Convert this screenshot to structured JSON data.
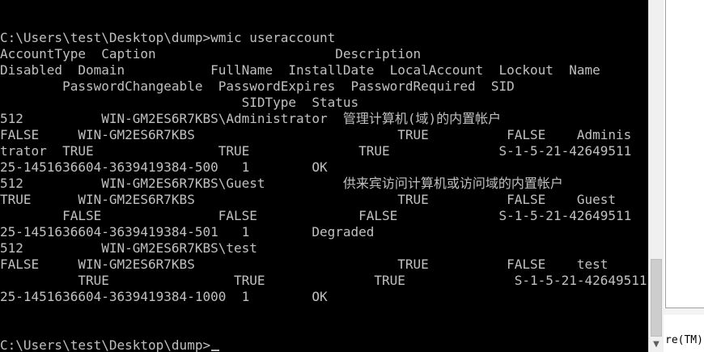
{
  "console": {
    "lines": [
      "",
      "",
      "C:\\Users\\test\\Desktop\\dump>wmic useraccount",
      "AccountType  Caption                       Description",
      "Disabled  Domain           FullName  InstallDate  LocalAccount  Lockout  Name",
      "        PasswordChangeable  PasswordExpires  PasswordRequired  SID",
      "                               SIDType  Status",
      "512          WIN-GM2ES6R7KBS\\Administrator  管理计算机(域)的内置帐户",
      "FALSE     WIN-GM2ES6R7KBS                          TRUE          FALSE    Adminis",
      "trator  TRUE                TRUE              TRUE              S-1-5-21-42649511",
      "25-1451636604-3639419384-500   1        OK",
      "512          WIN-GM2ES6R7KBS\\Guest          供来宾访问计算机或访问域的内置帐户",
      "TRUE      WIN-GM2ES6R7KBS                          TRUE          FALSE    Guest",
      "        FALSE               FALSE             FALSE             S-1-5-21-42649511",
      "25-1451636604-3639419384-501   1        Degraded",
      "512          WIN-GM2ES6R7KBS\\test",
      "FALSE     WIN-GM2ES6R7KBS                          TRUE          FALSE    test",
      "          TRUE                TRUE              TRUE              S-1-5-21-42649511",
      "25-1451636604-3639419384-1000  1        OK",
      "",
      "",
      "C:\\Users\\test\\Desktop\\dump>"
    ]
  },
  "background_window": {
    "partial_text": "re(TM)"
  },
  "colors": {
    "console_bg": "#000000",
    "console_fg": "#c0c0c0",
    "scrollbar_bg": "#f0f0f0",
    "scroll_thumb": "#cdcdcd"
  },
  "icons": {
    "scroll_down": "▼"
  }
}
